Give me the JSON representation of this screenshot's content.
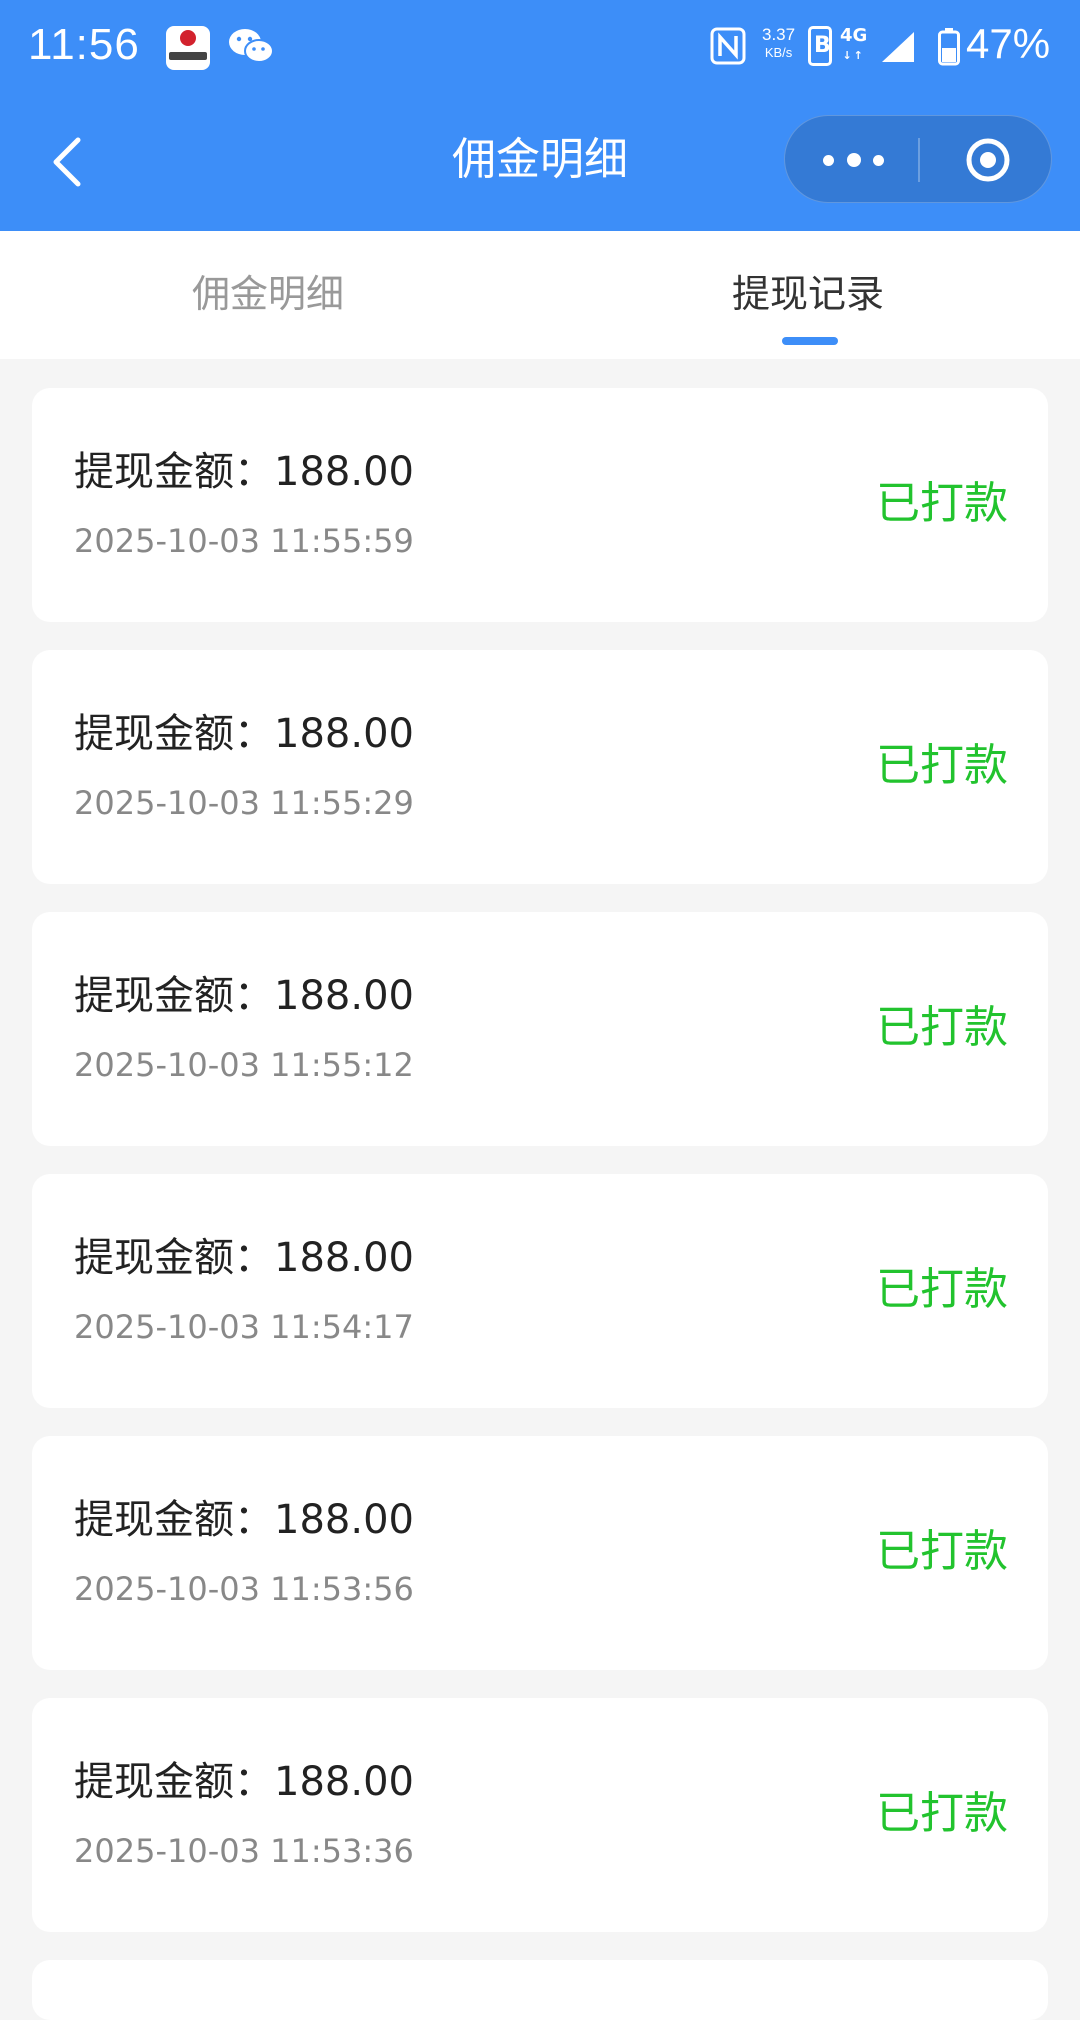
{
  "status_bar": {
    "time": "11:56",
    "speed_value": "3.37",
    "speed_unit": "KB/s",
    "network": "4G",
    "battery": "47%"
  },
  "nav": {
    "title": "佣金明细"
  },
  "tabs": [
    {
      "label": "佣金明细",
      "active": false
    },
    {
      "label": "提现记录",
      "active": true
    }
  ],
  "records": [
    {
      "label": "提现金额：",
      "amount": "188.00",
      "time": "2025-10-03 11:55:59",
      "status": "已打款"
    },
    {
      "label": "提现金额：",
      "amount": "188.00",
      "time": "2025-10-03 11:55:29",
      "status": "已打款"
    },
    {
      "label": "提现金额：",
      "amount": "188.00",
      "time": "2025-10-03 11:55:12",
      "status": "已打款"
    },
    {
      "label": "提现金额：",
      "amount": "188.00",
      "time": "2025-10-03 11:54:17",
      "status": "已打款"
    },
    {
      "label": "提现金额：",
      "amount": "188.00",
      "time": "2025-10-03 11:53:56",
      "status": "已打款"
    },
    {
      "label": "提现金额：",
      "amount": "188.00",
      "time": "2025-10-03 11:53:36",
      "status": "已打款"
    }
  ],
  "colors": {
    "primary": "#3d8ef8",
    "status_paid": "#22c32e",
    "background": "#f5f5f5"
  },
  "icons": [
    "back-arrow-icon",
    "more-dots-icon",
    "close-circle-icon",
    "nfc-icon",
    "signal-icon",
    "battery-icon",
    "wechat-icon"
  ]
}
